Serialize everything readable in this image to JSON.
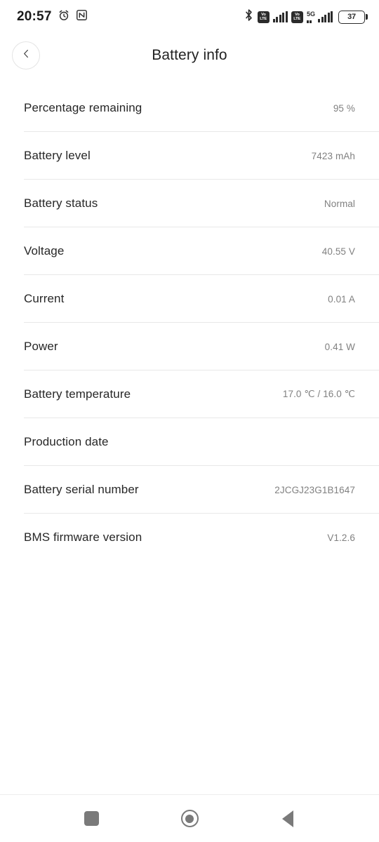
{
  "status_bar": {
    "time": "20:57",
    "icons": [
      {
        "name": "alarm-clock-icon"
      },
      {
        "name": "nfc-icon"
      },
      {
        "name": "bluetooth-icon"
      },
      {
        "name": "volte-icon-sim1"
      },
      {
        "name": "signal-bars-icon-sim1"
      },
      {
        "name": "volte-icon-sim2"
      },
      {
        "name": "5g-icon"
      },
      {
        "name": "signal-bars-icon-sim2"
      },
      {
        "name": "battery-icon"
      }
    ],
    "volte_top": "Vo",
    "volte_bottom": "LTE",
    "network_type": "5G",
    "battery_percent": "37"
  },
  "header": {
    "title": "Battery info",
    "back_icon": "chevron-left-icon"
  },
  "rows": [
    {
      "label": "Percentage remaining",
      "value": "95 %"
    },
    {
      "label": "Battery level",
      "value": "7423 mAh"
    },
    {
      "label": "Battery status",
      "value": "Normal"
    },
    {
      "label": "Voltage",
      "value": "40.55 V"
    },
    {
      "label": "Current",
      "value": "0.01 A"
    },
    {
      "label": "Power",
      "value": "0.41 W"
    },
    {
      "label": "Battery temperature",
      "value": "17.0 ℃ / 16.0 ℃"
    },
    {
      "label": "Production date",
      "value": ""
    },
    {
      "label": "Battery serial number",
      "value": "2JCGJ23G1B1647"
    },
    {
      "label": "BMS firmware version",
      "value": "V1.2.6"
    }
  ],
  "nav_bar": {
    "recents_icon": "square-recents-icon",
    "home_icon": "circle-home-icon",
    "back_icon": "triangle-back-icon"
  },
  "colors": {
    "background": "#ffffff",
    "label_text": "#272727",
    "value_text": "#808080",
    "divider": "#e8e8e8",
    "nav_icon": "#7a7a7a"
  }
}
